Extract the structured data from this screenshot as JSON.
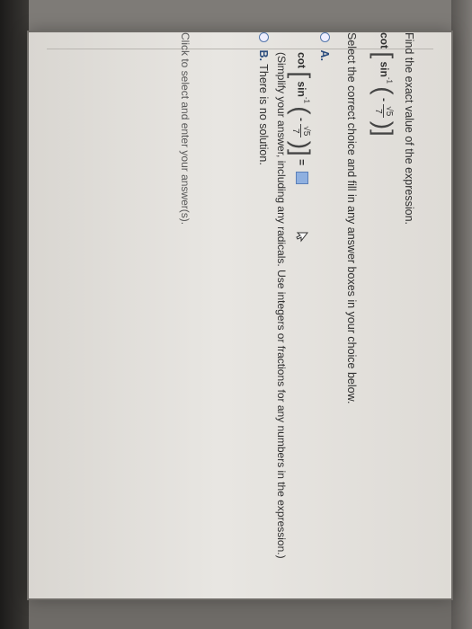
{
  "question": {
    "prompt": "Find the exact value of the expression.",
    "expression": {
      "fn_outer": "cot",
      "fn_inner": "sin",
      "exponent": "-1",
      "sign": "-",
      "numerator": "√5",
      "denominator": "7"
    }
  },
  "instructions": "Select the correct choice and fill in any answer boxes in your choice below.",
  "options": [
    {
      "label": "A.",
      "hint": "(Simplify your answer, including any radicals. Use integers or fractions for any numbers in the expression.)",
      "equals": "="
    },
    {
      "label": "B.",
      "text": "There is no solution."
    }
  ],
  "footer": "Click to select and enter your answer(s).",
  "colors": {
    "accent": "#2c4d7e",
    "answer_box": "#8fb0e0",
    "screen_bg": "#e8e6e2"
  },
  "icons": [
    "radio-unselected-icon",
    "mouse-cursor-icon",
    "answer-input-box"
  ]
}
